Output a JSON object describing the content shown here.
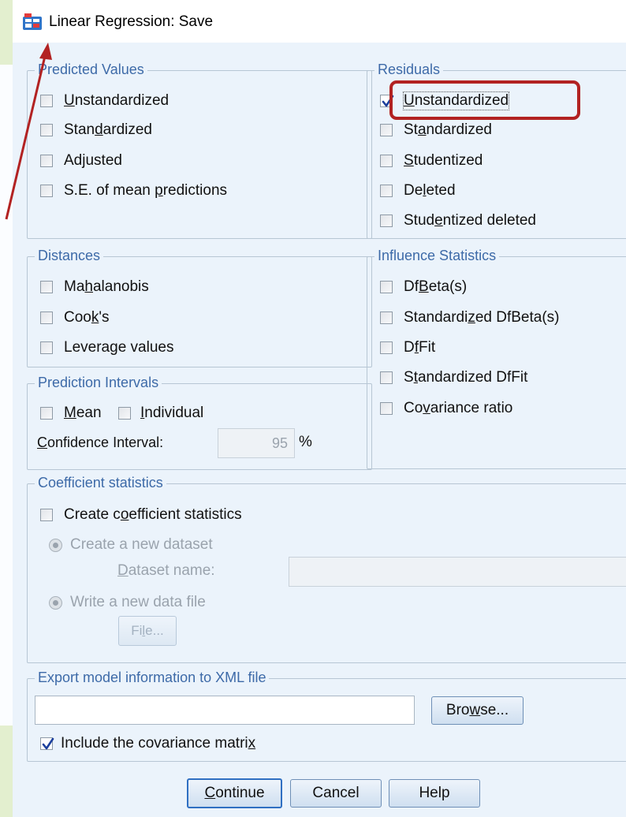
{
  "window": {
    "title": "Linear Regression: Save",
    "icon": "spss-table-icon"
  },
  "predicted_values": {
    "legend": "Predicted Values",
    "items": [
      {
        "pre": "",
        "u": "U",
        "post": "nstandardized",
        "checked": false
      },
      {
        "pre": "Stan",
        "u": "d",
        "post": "ardized",
        "checked": false
      },
      {
        "pre": "Ad",
        "u": "j",
        "post": "usted",
        "checked": false
      },
      {
        "pre": "S.E. of mean ",
        "u": "p",
        "post": "redictions",
        "checked": false
      }
    ]
  },
  "residuals": {
    "legend": "Residuals",
    "items": [
      {
        "pre": "",
        "u": "U",
        "post": "nstandardized",
        "checked": true
      },
      {
        "pre": "St",
        "u": "a",
        "post": "ndardized",
        "checked": false
      },
      {
        "pre": "",
        "u": "S",
        "post": "tudentized",
        "checked": false
      },
      {
        "pre": "De",
        "u": "l",
        "post": "eted",
        "checked": false
      },
      {
        "pre": "Stud",
        "u": "e",
        "post": "ntized deleted",
        "checked": false
      }
    ]
  },
  "distances": {
    "legend": "Distances",
    "items": [
      {
        "pre": "Ma",
        "u": "h",
        "post": "alanobis",
        "checked": false
      },
      {
        "pre": "Coo",
        "u": "k",
        "post": "'s",
        "checked": false
      },
      {
        "pre": "Levera",
        "u": "g",
        "post": "e values",
        "checked": false
      }
    ]
  },
  "influence": {
    "legend": "Influence Statistics",
    "items": [
      {
        "pre": "Df",
        "u": "B",
        "post": "eta(s)",
        "checked": false
      },
      {
        "pre": "Standardi",
        "u": "z",
        "post": "ed DfBeta(s)",
        "checked": false
      },
      {
        "pre": "D",
        "u": "f",
        "post": "Fit",
        "checked": false
      },
      {
        "pre": "S",
        "u": "t",
        "post": "andardized DfFit",
        "checked": false
      },
      {
        "pre": "Co",
        "u": "v",
        "post": "ariance ratio",
        "checked": false
      }
    ]
  },
  "prediction_intervals": {
    "legend": "Prediction Intervals",
    "mean": {
      "pre": "",
      "u": "M",
      "post": "ean",
      "checked": false
    },
    "individual": {
      "pre": "",
      "u": "I",
      "post": "ndividual",
      "checked": false
    },
    "ci_label": {
      "pre": "",
      "u": "C",
      "post": "onfidence Interval:"
    },
    "ci_value": "95",
    "ci_unit": "%"
  },
  "coefficient": {
    "legend": "Coefficient statistics",
    "create": {
      "pre": "Create c",
      "u": "o",
      "post": "efficient statistics",
      "checked": false
    },
    "new_dataset": "Create a new dataset",
    "dataset_name": {
      "pre": "",
      "u": "D",
      "post": "ataset name:"
    },
    "write_file": "Write a new data file",
    "file_button": {
      "pre": "Fi",
      "u": "l",
      "post": "e..."
    }
  },
  "export": {
    "legend": "Export model information to XML file",
    "path_value": "",
    "browse": {
      "pre": "Bro",
      "u": "w",
      "post": "se..."
    },
    "include_cov": {
      "pre": "Include the covariance matri",
      "u": "x",
      "post": "",
      "checked": true
    }
  },
  "buttons": {
    "continue": {
      "pre": "",
      "u": "C",
      "post": "ontinue"
    },
    "cancel": "Cancel",
    "help": "Help"
  },
  "annotation": {
    "highlight_color": "#b22222",
    "arrow_color": "#b22222"
  }
}
